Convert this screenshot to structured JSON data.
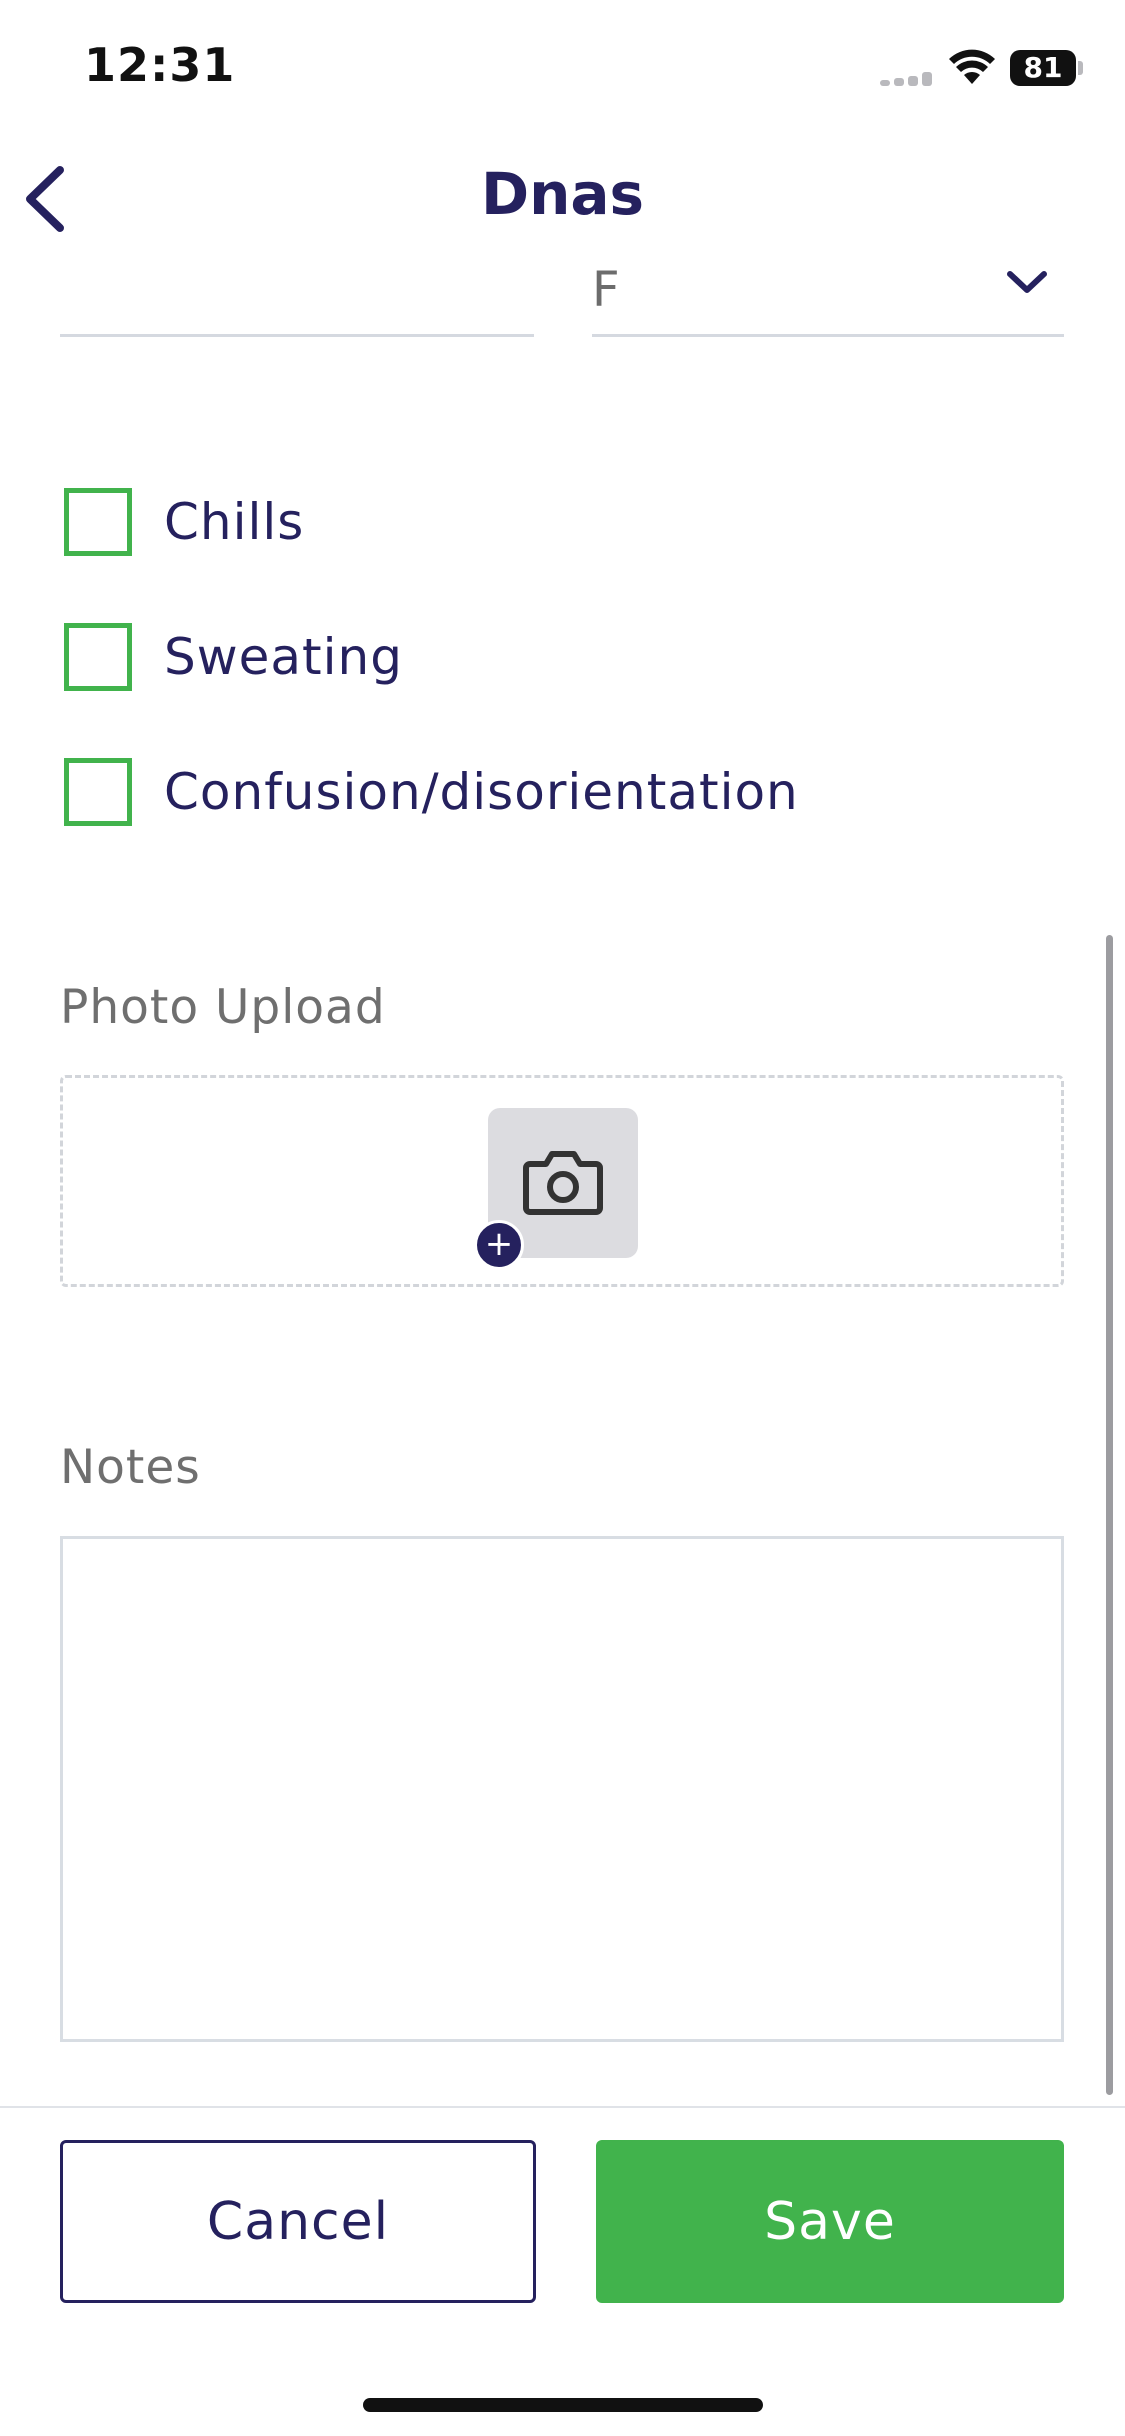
{
  "status_bar": {
    "time": "12:31",
    "battery": "81",
    "icons": [
      "signal-icon",
      "wifi-icon",
      "battery-icon"
    ]
  },
  "nav": {
    "title": "Dnas",
    "back_icon": "chevron-left-icon"
  },
  "temperature_field": {
    "unit_value": "F",
    "dropdown_icon": "chevron-down-icon"
  },
  "symptoms": [
    {
      "label": "Chills",
      "checked": false
    },
    {
      "label": "Sweating",
      "checked": false
    },
    {
      "label": "Confusion/disorientation",
      "checked": false
    }
  ],
  "photo_upload": {
    "label": "Photo Upload",
    "icon": "camera-icon",
    "badge": "+"
  },
  "notes": {
    "label": "Notes",
    "value": ""
  },
  "actions": {
    "cancel_label": "Cancel",
    "save_label": "Save"
  },
  "colors": {
    "primary_navy": "#25215e",
    "accent_green": "#41b34c",
    "muted_text": "#6f6f6f",
    "border": "#d8dde3"
  }
}
